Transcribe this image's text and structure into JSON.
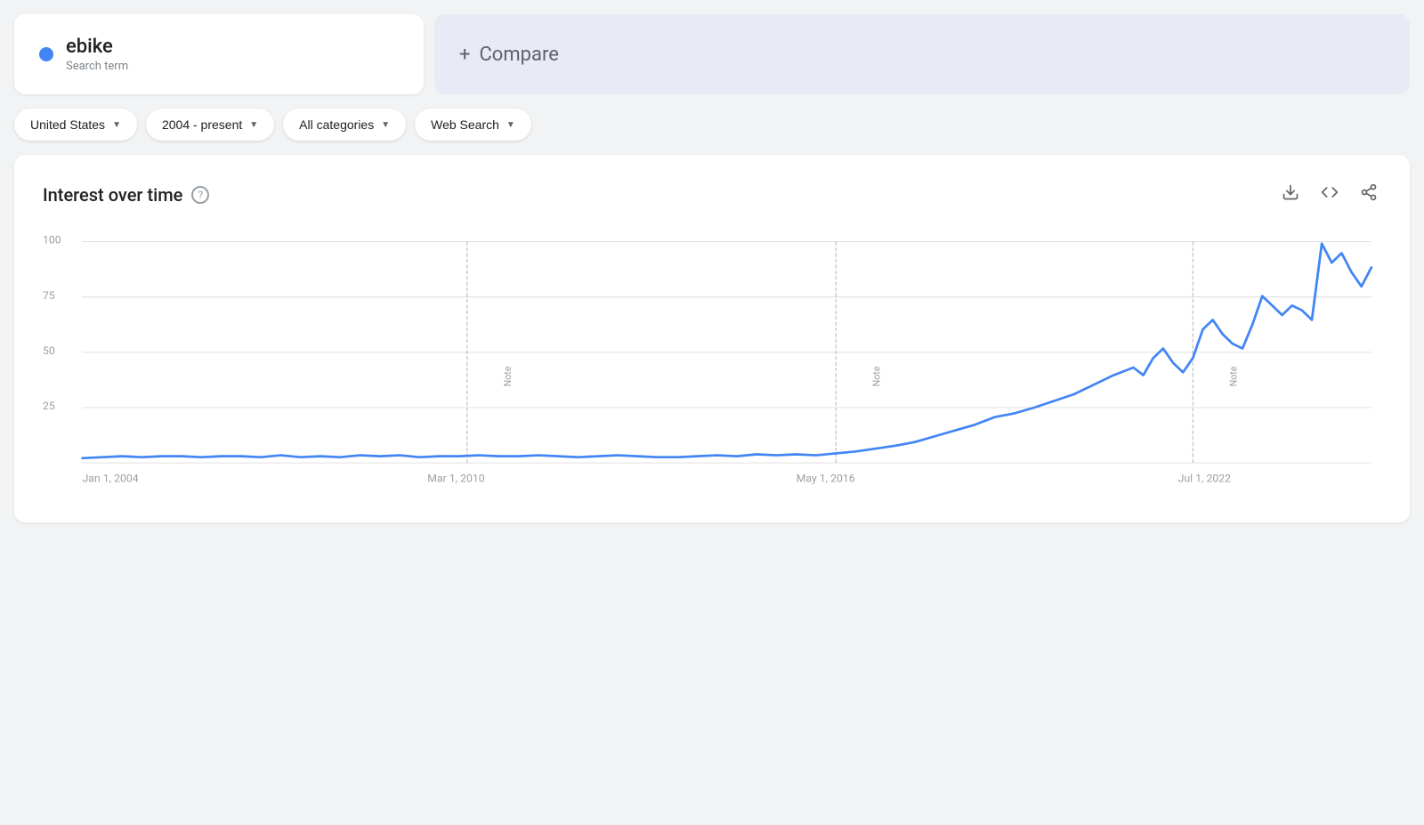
{
  "search_term": {
    "name": "ebike",
    "label": "Search term",
    "dot_color": "#4285f4"
  },
  "compare": {
    "label": "Compare",
    "plus": "+"
  },
  "filters": [
    {
      "id": "region",
      "label": "United States"
    },
    {
      "id": "time_range",
      "label": "2004 - present"
    },
    {
      "id": "category",
      "label": "All categories"
    },
    {
      "id": "search_type",
      "label": "Web Search"
    }
  ],
  "chart": {
    "title": "Interest over time",
    "help_tooltip": "?",
    "actions": {
      "download": "⬇",
      "embed": "<>",
      "share": "↗"
    },
    "y_axis_labels": [
      "100",
      "75",
      "50",
      "25",
      ""
    ],
    "x_axis_labels": [
      "Jan 1, 2004",
      "Mar 1, 2010",
      "May 1, 2016",
      "Jul 1, 2022"
    ],
    "notes": [
      {
        "id": "note1",
        "label": "Note"
      },
      {
        "id": "note2",
        "label": "Note"
      },
      {
        "id": "note3",
        "label": "Note"
      }
    ]
  }
}
